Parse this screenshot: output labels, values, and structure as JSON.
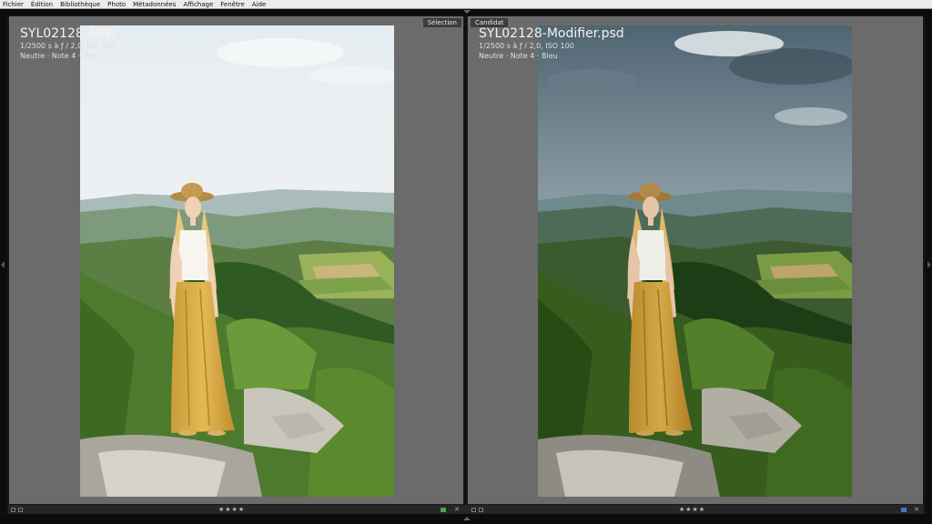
{
  "menu": [
    "Fichier",
    "Édition",
    "Bibliothèque",
    "Photo",
    "Métadonnées",
    "Affichage",
    "Fenêtre",
    "Aide"
  ],
  "left_pane": {
    "label": "Sélection",
    "filename": "SYL02128.ARW",
    "exposure": "1/2500 s à ƒ / 2,0, ISO 100",
    "tags": "Neutre  ·  Note 4  ·  Vert",
    "stars": "★★★★",
    "color_label": "#4aa84a"
  },
  "right_pane": {
    "label": "Candidat",
    "filename": "SYL02128-Modifier.psd",
    "exposure": "1/2500 s à ƒ / 2,0, ISO 100",
    "tags": "Neutre  ·  Note 4  ·  Bleu",
    "stars": "★★★★",
    "color_label": "#4a72c8"
  },
  "toolbar": {
    "close_glyph": "✕"
  },
  "colors": {
    "pane_bg": "#6b6b6b",
    "chrome_dark": "#0c0c0c",
    "menubar_bg": "#ececec"
  }
}
